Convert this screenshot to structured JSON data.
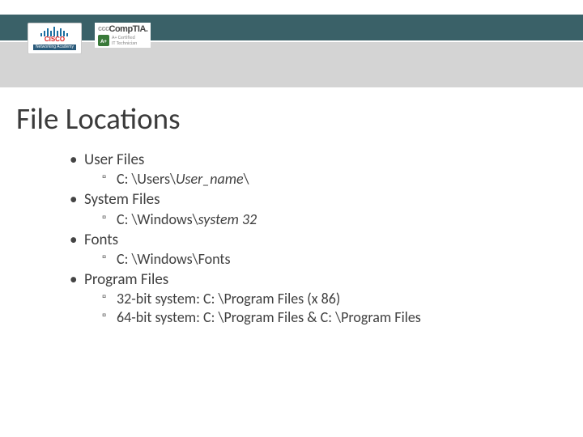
{
  "logos": {
    "cisco": {
      "brand": "CISCO",
      "sub": "Networking Academy"
    },
    "comptia": {
      "prefix": "ccc",
      "brand": "CompTIA.",
      "badge": "A+",
      "cert_line1": "A+ Certified",
      "cert_line2": "IT Technician"
    }
  },
  "title": "File Locations",
  "bullets": [
    {
      "label": "User Files",
      "items": [
        {
          "plain": "C: \\Users\\",
          "italic": "User_name",
          "suffix": "\\"
        }
      ]
    },
    {
      "label": "System Files",
      "items": [
        {
          "plain": "C: \\Windows\\",
          "italic": "system 32",
          "suffix": ""
        }
      ]
    },
    {
      "label": "Fonts",
      "items": [
        {
          "plain": "C: \\Windows\\Fonts",
          "italic": "",
          "suffix": ""
        }
      ]
    },
    {
      "label": "Program Files",
      "items": [
        {
          "plain": "32-bit system: C: \\Program Files (x 86)",
          "italic": "",
          "suffix": ""
        },
        {
          "plain": "64-bit system: C: \\Program Files  & C: \\Program Files",
          "italic": "",
          "suffix": ""
        }
      ]
    }
  ]
}
